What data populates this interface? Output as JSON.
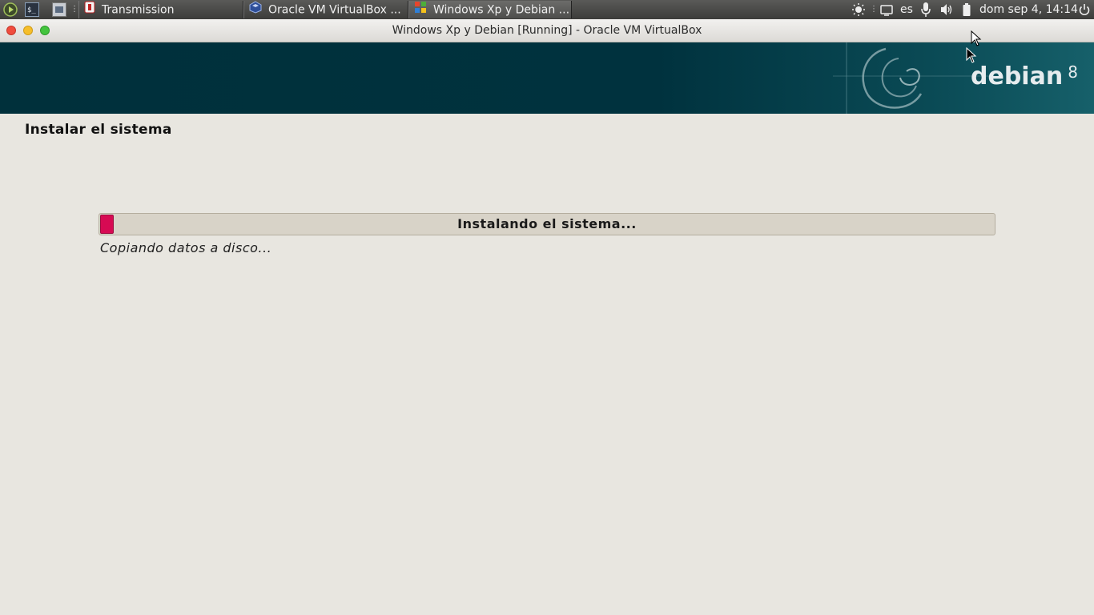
{
  "panel": {
    "tasks": [
      {
        "label": "Transmission",
        "icon": "transmission-icon",
        "active": false
      },
      {
        "label": "Oracle VM VirtualBox ...",
        "icon": "virtualbox-icon",
        "active": false
      },
      {
        "label": "Windows Xp y Debian ...",
        "icon": "windows-icon",
        "active": true
      }
    ],
    "keyboard_layout": "es",
    "clock": "dom sep  4, 14:14"
  },
  "window": {
    "title": "Windows Xp y Debian [Running] - Oracle VM VirtualBox"
  },
  "banner": {
    "logo_text": "debian",
    "version": "8"
  },
  "installer": {
    "step_title": "Instalar el sistema",
    "progress_label": "Instalando el sistema...",
    "progress_fraction": 0.015,
    "status_text": "Copiando datos a disco...",
    "progress_color": "#d70a53"
  }
}
